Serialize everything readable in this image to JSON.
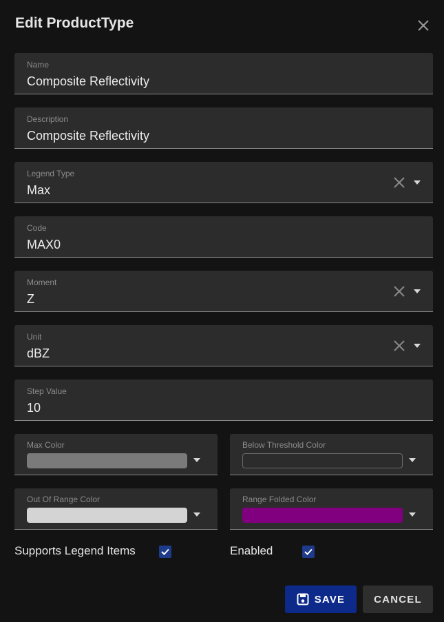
{
  "dialog": {
    "title": "Edit ProductType"
  },
  "fields": {
    "name": {
      "label": "Name",
      "value": "Composite Reflectivity"
    },
    "description": {
      "label": "Description",
      "value": "Composite Reflectivity"
    },
    "legend_type": {
      "label": "Legend Type",
      "value": "Max"
    },
    "code": {
      "label": "Code",
      "value": "MAX0"
    },
    "moment": {
      "label": "Moment",
      "value": "Z"
    },
    "unit": {
      "label": "Unit",
      "value": "dBZ"
    },
    "step_value": {
      "label": "Step Value",
      "value": "10"
    }
  },
  "colors": {
    "max_color": {
      "label": "Max Color",
      "color": "#7a7a7a"
    },
    "below_threshold_color": {
      "label": "Below Threshold Color",
      "color": "#2c2c2c"
    },
    "out_of_range_color": {
      "label": "Out Of Range Color",
      "color": "#d4d4d4"
    },
    "range_folded_color": {
      "label": "Range Folded Color",
      "color": "#800080"
    }
  },
  "checkboxes": {
    "supports_legend_items": {
      "label": "Supports Legend Items",
      "checked": true
    },
    "enabled": {
      "label": "Enabled",
      "checked": true
    }
  },
  "buttons": {
    "save": "SAVE",
    "cancel": "CANCEL"
  },
  "icons": {
    "close": "close-icon",
    "save": "floppy-disk-icon",
    "check": "check-icon",
    "clear": "clear-x-icon",
    "dropdown": "chevron-down-icon"
  }
}
